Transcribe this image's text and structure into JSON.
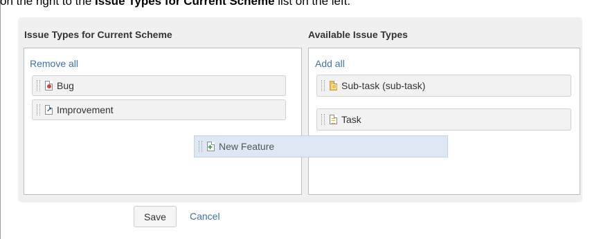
{
  "header_text": {
    "prefix": "on the right to the ",
    "bold": "Issue Types for Current Scheme",
    "suffix": " list on the left."
  },
  "current_scheme": {
    "title": "Issue Types for Current Scheme",
    "action_label": "Remove all",
    "items": [
      {
        "label": "Bug",
        "icon": "bug-icon"
      },
      {
        "label": "Improvement",
        "icon": "improvement-icon"
      }
    ]
  },
  "available": {
    "title": "Available Issue Types",
    "action_label": "Add all",
    "items": [
      {
        "label": "Sub-task (sub-task)",
        "icon": "subtask-icon"
      },
      {
        "label": "Task",
        "icon": "task-icon"
      }
    ]
  },
  "dragging_item": {
    "label": "New Feature",
    "icon": "new-feature-icon"
  },
  "buttons": {
    "save": "Save",
    "cancel": "Cancel"
  },
  "colors": {
    "link": "#3b73af",
    "bug": "#d04437",
    "new_feature": "#14892c",
    "subtask": "#f6c342",
    "drag_highlight": "#dde8f4"
  }
}
